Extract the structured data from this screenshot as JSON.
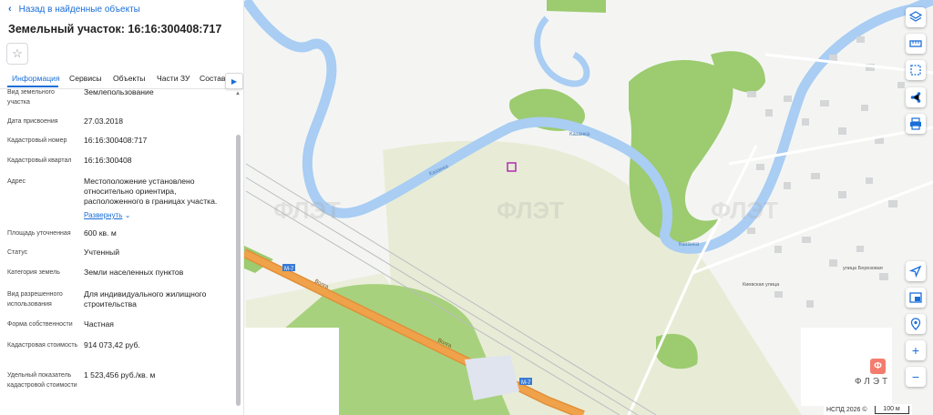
{
  "header": {
    "back_label": "Назад в найденные объекты",
    "title": "Земельный участок: 16:16:300408:717"
  },
  "tabs": [
    "Информация",
    "Сервисы",
    "Объекты",
    "Части ЗУ",
    "Состав"
  ],
  "active_tab": "Информация",
  "info": {
    "land_type_label": "Вид земельного участка",
    "land_type_value": "Землепользование",
    "date_label": "Дата присвоения",
    "date_value": "27.03.2018",
    "cad_number_label": "Кадастровый номер",
    "cad_number_value": "16:16:300408:717",
    "cad_quarter_label": "Кадастровый квартал",
    "cad_quarter_value": "16:16:300408",
    "address_label": "Адрес",
    "address_value": "Местоположение установлено относительно ориентира, расположенного в границах участка.",
    "expand_label": "Развернуть",
    "area_label": "Площадь уточненная",
    "area_value": "600 кв. м",
    "status_label": "Статус",
    "status_value": "Учтенный",
    "category_label": "Категория земель",
    "category_value": "Земли населенных пунктов",
    "permitted_use_label": "Вид разрешенного использования",
    "permitted_use_value": "Для индивидуального жилищного строительства",
    "ownership_label": "Форма собственности",
    "ownership_value": "Частная",
    "cad_value_label": "Кадастровая стоимость",
    "cad_value_value": "914 073,42 руб.",
    "specific_label": "Удельный показатель кадастровой стоимости",
    "specific_value": "1 523,456 руб./кв. м"
  },
  "map": {
    "river_label": "Казанка",
    "road_label": "Киевская улица",
    "street_label": "улица Березовая",
    "highway_label": "Волга",
    "route_badge": "М-7",
    "watermark": "ФЛЭТ",
    "logo_letter": "Ф",
    "attribution": "НСПД 2026 ©",
    "scale_label": "100 м"
  },
  "colors": {
    "accent": "#1a6ed8",
    "river": "#a9cdf3",
    "forest": "#9ccb70",
    "field": "#e8ecd6",
    "highway": "#f0a24a",
    "logo": "#f47c6e"
  },
  "icons": {
    "back": "chevron-left-icon",
    "favorite": "star-icon",
    "layers": "layers-icon",
    "ruler": "ruler-icon",
    "select": "select-area-icon",
    "share": "share-icon",
    "print": "print-icon",
    "locate": "geolocation-icon",
    "minimap": "minimap-icon",
    "marker": "marker-icon",
    "zoom_in": "plus-icon",
    "zoom_out": "minus-icon"
  }
}
